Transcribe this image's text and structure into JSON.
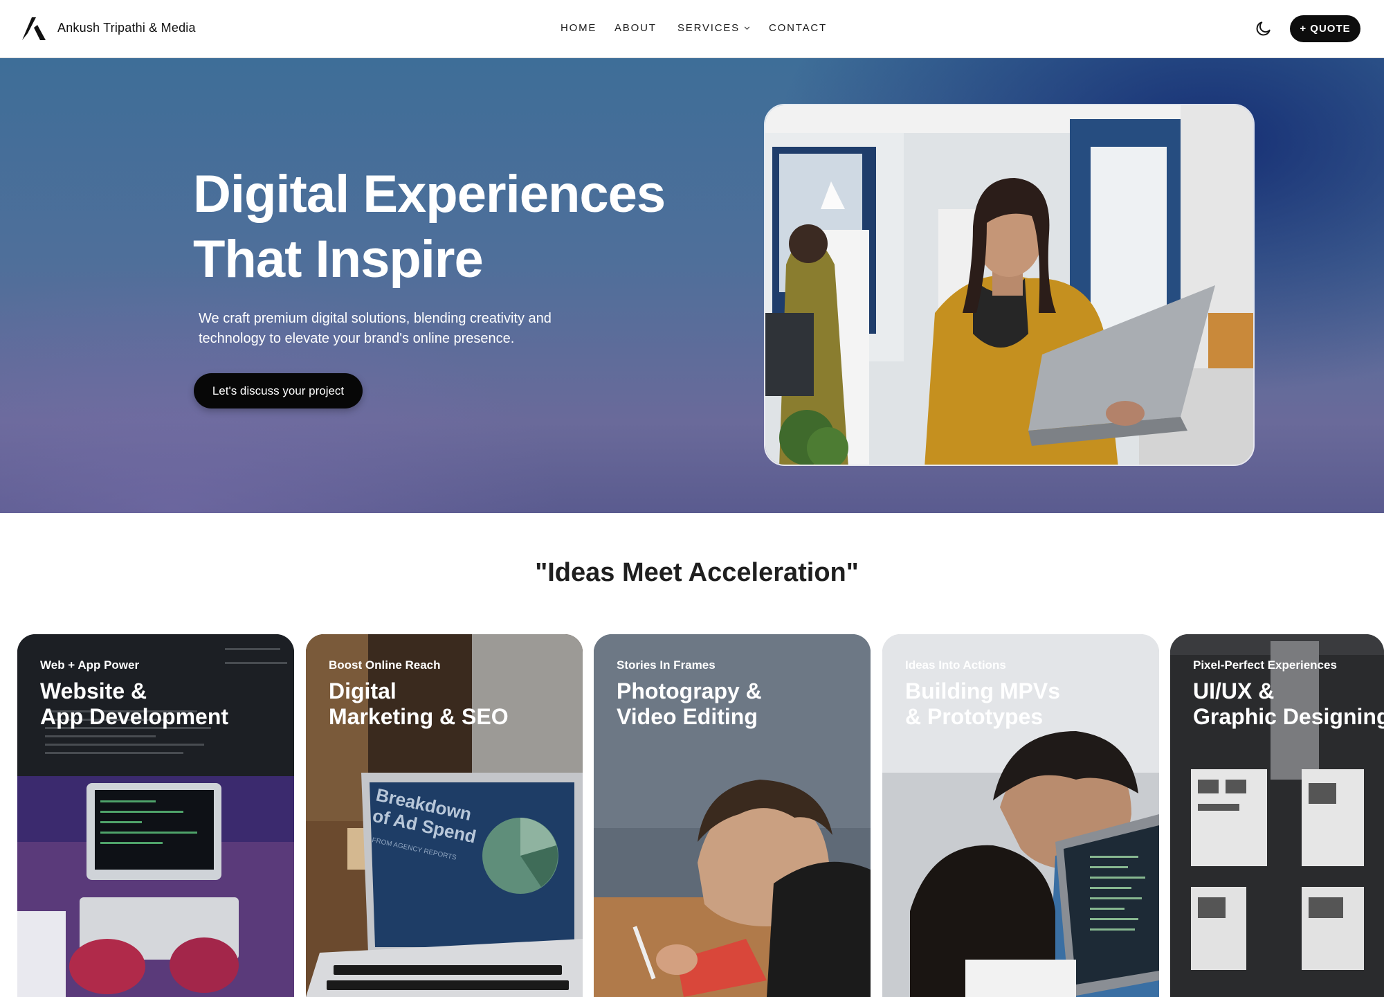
{
  "header": {
    "brand": "Ankush Tripathi & Media",
    "logo_icon": "brand-logo-icon",
    "nav": [
      "HOME",
      "ABOUT",
      "SERVICES",
      "CONTACT"
    ],
    "theme_toggle_icon": "moon-icon",
    "quote_button": "+ QUOTE"
  },
  "hero": {
    "title_line1": "Digital Experiences",
    "title_line2": "That Inspire",
    "subtitle": "We craft premium digital solutions, blending creativity and technology to elevate your brand's online presence.",
    "cta": "Let's discuss your project",
    "gradient_colors": [
      "#3e6e98",
      "#6a6a9a",
      "#0e246e"
    ]
  },
  "section": {
    "title": "\"Ideas Meet Acceleration\""
  },
  "cards": [
    {
      "kicker": "Web + App Power",
      "title_line1": "Website &",
      "title_line2": "App Development"
    },
    {
      "kicker": "Boost Online Reach",
      "title_line1": "Digital",
      "title_line2": "Marketing & SEO",
      "screen_text1": "Breakdown",
      "screen_text2": "of Ad Spend",
      "screen_text3": "FROM AGENCY REPORTS"
    },
    {
      "kicker": "Stories In Frames",
      "title_line1": "Photograpy &",
      "title_line2": "Video Editing"
    },
    {
      "kicker": "Ideas Into Actions",
      "title_line1": "Building MPVs",
      "title_line2": "& Prototypes"
    },
    {
      "kicker": "Pixel-Perfect Experiences",
      "title_line1": "UI/UX &",
      "title_line2": "Graphic Designing"
    }
  ]
}
